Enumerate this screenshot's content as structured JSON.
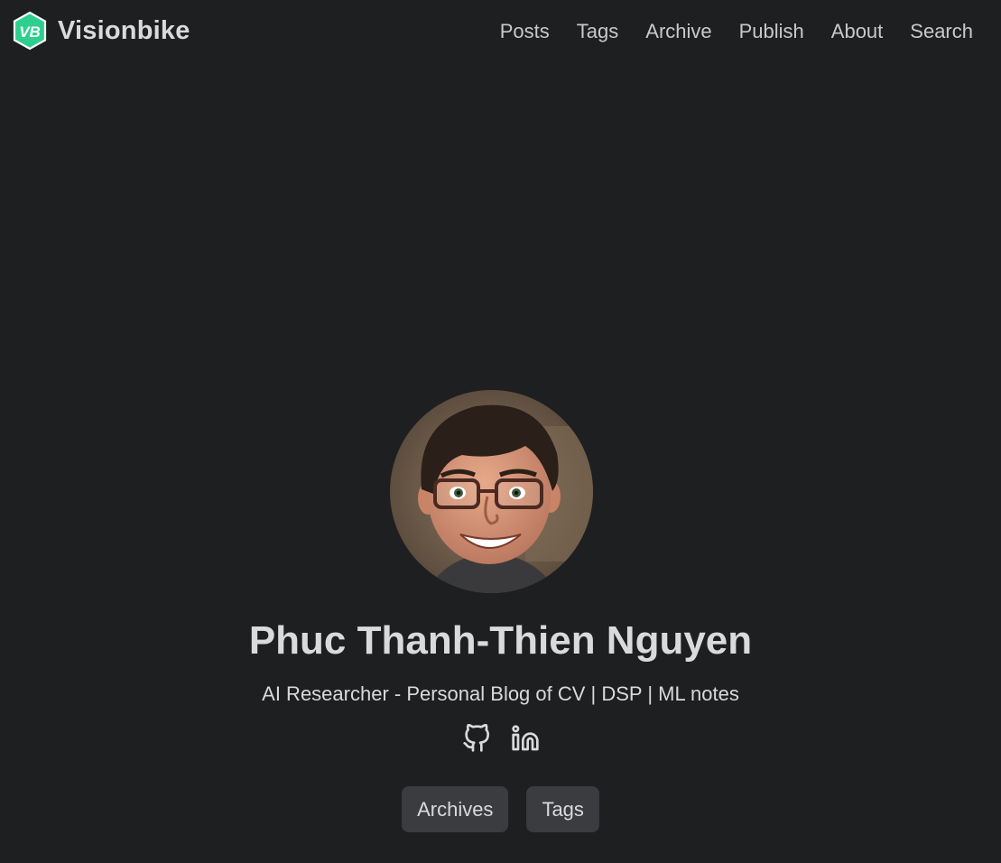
{
  "header": {
    "brand_name": "Visionbike",
    "nav": [
      {
        "label": "Posts"
      },
      {
        "label": "Tags"
      },
      {
        "label": "Archive"
      },
      {
        "label": "Publish"
      },
      {
        "label": "About"
      },
      {
        "label": "Search"
      }
    ]
  },
  "profile": {
    "name": "Phuc Thanh-Thien Nguyen",
    "subtitle": "AI Researcher - Personal Blog of CV | DSP | ML notes",
    "social_icons": [
      "github-icon",
      "linkedin-icon"
    ],
    "buttons": [
      {
        "label": "Archives"
      },
      {
        "label": "Tags"
      }
    ]
  },
  "colors": {
    "background": "#1e1f21",
    "text": "#dadadb",
    "button_bg": "#3b3c3f",
    "logo_green": "#2ecf8e"
  }
}
